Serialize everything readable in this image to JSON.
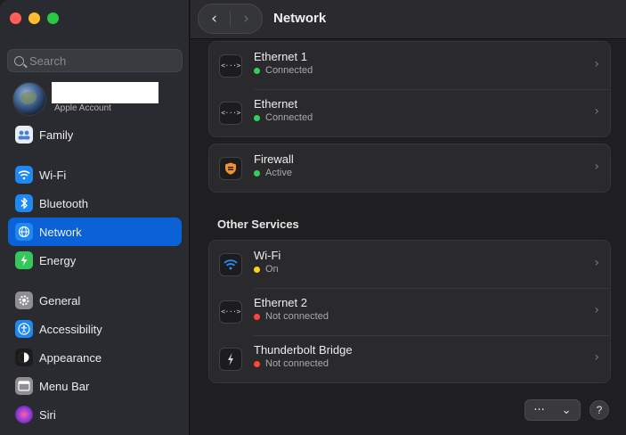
{
  "window": {
    "title": "Network"
  },
  "sidebar": {
    "search_placeholder": "Search",
    "account": {
      "subtitle": "Apple Account"
    },
    "items": [
      {
        "label": "Family",
        "icon": "family-icon",
        "color": "#e8eef8",
        "selected": false
      },
      {
        "label": "Wi-Fi",
        "icon": "wifi-icon",
        "color": "#1e88f5",
        "selected": false
      },
      {
        "label": "Bluetooth",
        "icon": "bluetooth-icon",
        "color": "#1e88f5",
        "selected": false
      },
      {
        "label": "Network",
        "icon": "globe-icon",
        "color": "#1e88f5",
        "selected": true
      },
      {
        "label": "Energy",
        "icon": "bolt-icon",
        "color": "#34c759",
        "selected": false
      },
      {
        "label": "General",
        "icon": "gear-icon",
        "color": "#8e8e93",
        "selected": false
      },
      {
        "label": "Accessibility",
        "icon": "accessibility-icon",
        "color": "#1e88f5",
        "selected": false
      },
      {
        "label": "Appearance",
        "icon": "appearance-icon",
        "color": "#1c1c1e",
        "selected": false
      },
      {
        "label": "Menu Bar",
        "icon": "menubar-icon",
        "color": "#8e8e93",
        "selected": false
      },
      {
        "label": "Siri",
        "icon": "siri-icon",
        "color": "#b04ad8",
        "selected": false
      }
    ]
  },
  "main": {
    "services": [
      {
        "title": "Ethernet 1",
        "status": "Connected",
        "status_color": "#30d158",
        "icon": "ethernet-icon"
      },
      {
        "title": "Ethernet",
        "status": "Connected",
        "status_color": "#30d158",
        "icon": "ethernet-icon"
      }
    ],
    "firewall": {
      "title": "Firewall",
      "status": "Active",
      "status_color": "#30d158",
      "icon": "firewall-icon",
      "color": "#f0932b"
    },
    "other_services_label": "Other Services",
    "other_services": [
      {
        "title": "Wi-Fi",
        "status": "On",
        "status_color": "#ffd60a",
        "icon": "wifi-icon"
      },
      {
        "title": "Ethernet 2",
        "status": "Not connected",
        "status_color": "#ff453a",
        "icon": "ethernet-icon"
      },
      {
        "title": "Thunderbolt Bridge",
        "status": "Not connected",
        "status_color": "#ff453a",
        "icon": "thunderbolt-icon"
      }
    ],
    "more_button": {
      "label": "···",
      "chevron": "⌄"
    },
    "help_button": {
      "label": "?"
    }
  }
}
